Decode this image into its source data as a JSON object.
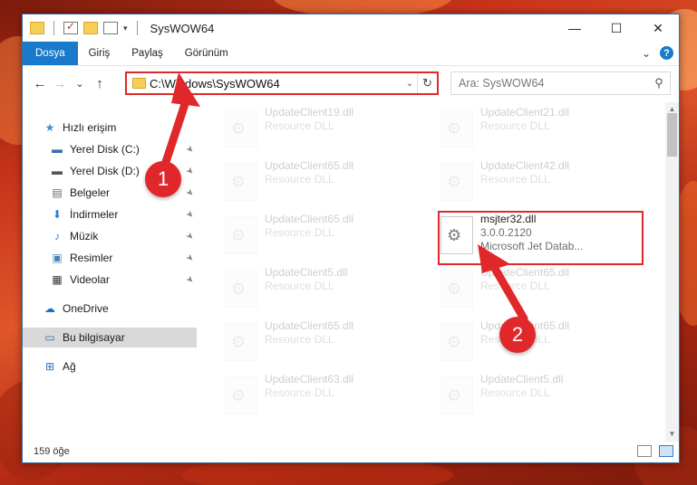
{
  "window": {
    "title": "SysWOW64",
    "minimize": "—",
    "maximize": "☐",
    "close": "✕"
  },
  "ribbon": {
    "tabs": [
      "Dosya",
      "Giriş",
      "Paylaş",
      "Görünüm"
    ],
    "collapse": "⌄",
    "help": "?"
  },
  "nav": {
    "back": "←",
    "forward": "→",
    "recent": "⌄",
    "up": "↑",
    "address": "C:\\Windows\\SysWOW64",
    "address_dropdown": "⌄",
    "refresh": "↻",
    "search_placeholder": "Ara: SysWOW64",
    "search_icon": "⚲"
  },
  "sidebar": {
    "items": [
      {
        "label": "Hızlı erişim",
        "icon": "star-icon",
        "glyph": "★",
        "color": "#3a8fd8",
        "pinned": false
      },
      {
        "label": "Yerel Disk (C:)",
        "icon": "drive-icon",
        "glyph": "▬",
        "color": "#3a6fb0",
        "pinned": true
      },
      {
        "label": "Yerel Disk (D:)",
        "icon": "drive-icon",
        "glyph": "▬",
        "color": "#555555",
        "pinned": true
      },
      {
        "label": "Belgeler",
        "icon": "documents-icon",
        "glyph": "▤",
        "color": "#6a6a6a",
        "pinned": true
      },
      {
        "label": "İndirmeler",
        "icon": "download-icon",
        "glyph": "⬇",
        "color": "#2c7cd6",
        "pinned": true
      },
      {
        "label": "Müzik",
        "icon": "music-icon",
        "glyph": "♪",
        "color": "#2c7cd6",
        "pinned": true
      },
      {
        "label": "Resimler",
        "icon": "pictures-icon",
        "glyph": "▣",
        "color": "#4a7fb8",
        "pinned": true
      },
      {
        "label": "Videolar",
        "icon": "video-icon",
        "glyph": "▦",
        "color": "#333333",
        "pinned": true
      },
      {
        "label": "OneDrive",
        "icon": "cloud-icon",
        "glyph": "☁",
        "color": "#1f6fc8",
        "pinned": false
      },
      {
        "label": "Bu bilgisayar",
        "icon": "computer-icon",
        "glyph": "▭",
        "color": "#2a6fb8",
        "pinned": false,
        "selected": true
      },
      {
        "label": "Ağ",
        "icon": "network-icon",
        "glyph": "⊞",
        "color": "#2a6fb8",
        "pinned": false
      }
    ],
    "pin_glyph": "📌"
  },
  "files": [
    {
      "name": "UpdateClient19.dll",
      "sub": "Resource DLL",
      "faded": true
    },
    {
      "name": "UpdateClient21.dll",
      "sub": "Resource DLL",
      "faded": true
    },
    {
      "name": "UpdateClient65.dll",
      "sub": "Resource DLL",
      "faded": true
    },
    {
      "name": "UpdateClient42.dll",
      "sub": "Resource DLL",
      "faded": true
    },
    {
      "name": "UpdateClient65.dll",
      "sub": "Resource DLL",
      "faded": true
    },
    {
      "name": "msjter32.dll",
      "sub": "3.0.0.2120",
      "sub2": "Microsoft Jet Datab...",
      "faded": false
    },
    {
      "name": "UpdateClient5.dll",
      "sub": "Resource DLL",
      "faded": true
    },
    {
      "name": "UpdateClient65.dll",
      "sub": "Resource DLL",
      "faded": true
    },
    {
      "name": "UpdateClient65.dll",
      "sub": "Resource DLL",
      "faded": true
    },
    {
      "name": "UpdateClient65.dll",
      "sub": "Resource DLL",
      "faded": true
    },
    {
      "name": "UpdateClient63.dll",
      "sub": "Resource DLL",
      "faded": true
    },
    {
      "name": "UpdateClient5.dll",
      "sub": "Resource DLL",
      "faded": true
    }
  ],
  "status": {
    "count": "159 öğe"
  },
  "callouts": {
    "one": "1",
    "two": "2",
    "color": "#e0282a"
  }
}
